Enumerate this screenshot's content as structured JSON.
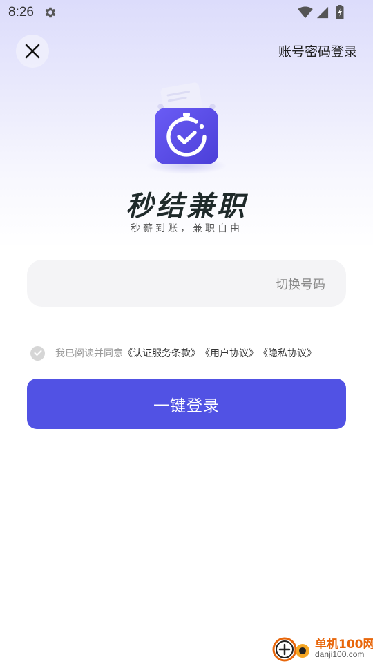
{
  "status_bar": {
    "time": "8:26",
    "icons": [
      "gear-icon",
      "wifi-icon",
      "signal-icon",
      "battery-charging-icon"
    ]
  },
  "header": {
    "close_icon": "close-icon",
    "account_login_label": "账号密码登录"
  },
  "brand": {
    "logo_icon": "stopwatch-check-icon",
    "title": "秒结兼职",
    "slogan": "秒薪到账，兼职自由"
  },
  "phone_field": {
    "value": "",
    "switch_label": "切换号码"
  },
  "agreement": {
    "checked": true,
    "prefix": "我已阅读并同意",
    "links": [
      "《认证服务条款》",
      "《用户协议》",
      "《隐私协议》"
    ]
  },
  "login_button": {
    "label": "一键登录"
  },
  "watermark": {
    "title": "单机100网",
    "url": "danji100.com"
  },
  "colors": {
    "accent": "#5152e4",
    "gradient_top": "#dcdcfb",
    "field_bg": "#f4f4f6"
  }
}
